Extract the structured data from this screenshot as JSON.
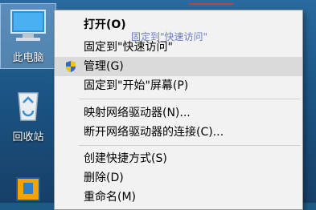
{
  "desktop": {
    "icons": [
      {
        "label": "此电脑"
      },
      {
        "label": "回收站"
      },
      {
        "label": ""
      }
    ]
  },
  "context_menu": {
    "items": [
      {
        "label": "打开(O)"
      },
      {
        "label": "固定到\"快速访问\""
      },
      {
        "label": "管理(G)"
      },
      {
        "label": "固定到\"开始\"屏幕(P)"
      },
      {
        "label": "映射网络驱动器(N)..."
      },
      {
        "label": "断开网络驱动器的连接(C)..."
      },
      {
        "label": "创建快捷方式(S)"
      },
      {
        "label": "删除(D)"
      },
      {
        "label": "重命名(M)"
      }
    ],
    "overlay_text": "固定到\"快速访问\""
  }
}
